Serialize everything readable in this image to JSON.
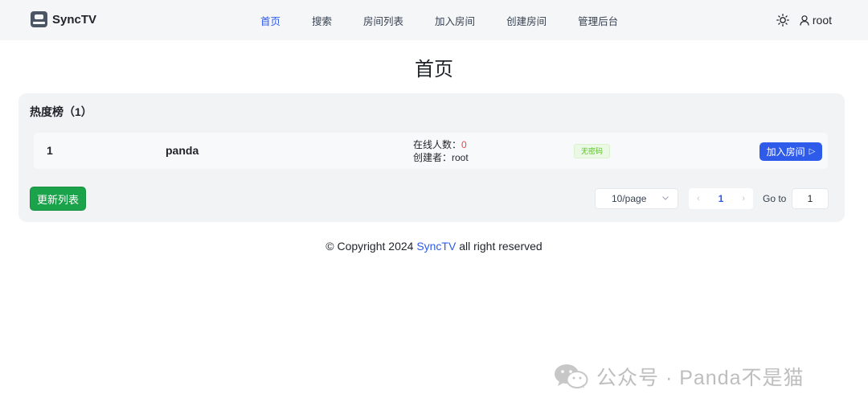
{
  "header": {
    "logo_text": "SyncTV",
    "nav": [
      {
        "label": "首页",
        "active": true
      },
      {
        "label": "搜索",
        "active": false
      },
      {
        "label": "房间列表",
        "active": false
      },
      {
        "label": "加入房间",
        "active": false
      },
      {
        "label": "创建房间",
        "active": false
      },
      {
        "label": "管理后台",
        "active": false
      }
    ],
    "theme_icon": "sun-icon",
    "user_icon": "user-icon",
    "user_name": "root"
  },
  "page_title": "首页",
  "hot_list": {
    "title": "热度榜（1）",
    "rooms": [
      {
        "rank": "1",
        "name": "panda",
        "online_label": "在线人数：",
        "online_count": "0",
        "creator_label": "创建者：",
        "creator": "root",
        "tag": "无密码",
        "join_label": "加入房间",
        "join_icon": "▷"
      }
    ],
    "refresh_label": "更新列表",
    "pagination": {
      "page_size": "10/page",
      "current_page": "1",
      "prev_icon": "‹",
      "next_icon": "›",
      "goto_label": "Go to",
      "goto_value": "1"
    }
  },
  "footer": {
    "prefix": "© Copyright 2024 ",
    "brand": "SyncTV",
    "suffix": " all right reserved"
  },
  "watermark": {
    "text": "公众号 · Panda不是猫",
    "icon": "wechat-icon"
  },
  "colors": {
    "accent": "#2f5bea",
    "success": "#1aa34a",
    "danger": "#e5484d",
    "tag_green": "#52c41a"
  }
}
